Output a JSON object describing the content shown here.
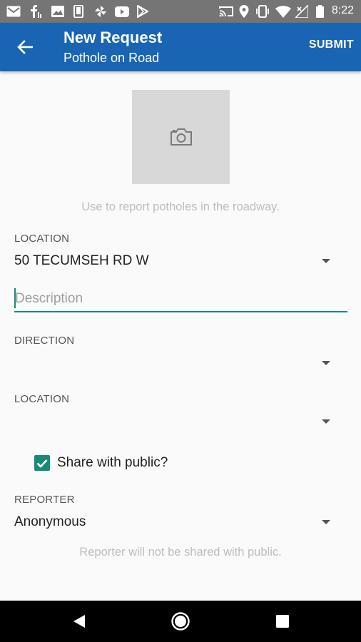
{
  "status_bar": {
    "time": "8:22",
    "left_icons": [
      "mail-icon",
      "facebook-icon",
      "image-icon",
      "phone-icon",
      "pinwheel-icon",
      "youtube-icon",
      "play-store-icon"
    ],
    "right_icons": [
      "cast-icon",
      "location-icon",
      "vibrate-icon",
      "wifi-icon",
      "no-signal-icon",
      "battery-icon"
    ]
  },
  "app_bar": {
    "title": "New Request",
    "subtitle": "Pothole on Road",
    "submit_label": "SUBMIT",
    "color": "#1a65b3"
  },
  "photo": {
    "icon": "camera-icon",
    "helper": "Use to report potholes in the roadway."
  },
  "form": {
    "location_label": "LOCATION",
    "location_value": "50 TECUMSEH RD W",
    "description_placeholder": "Description",
    "description_value": "",
    "direction_label": "DIRECTION",
    "direction_value": "",
    "location2_label": "LOCATION",
    "location2_value": "",
    "share_label": "Share with public?",
    "share_checked": true,
    "reporter_label": "REPORTER",
    "reporter_value": "Anonymous",
    "reporter_helper": "Reporter will not be shared with public.",
    "accent_color": "#1a8a78"
  },
  "nav_bar": {
    "buttons": [
      "back-nav-icon",
      "home-nav-icon",
      "recents-nav-icon"
    ]
  }
}
